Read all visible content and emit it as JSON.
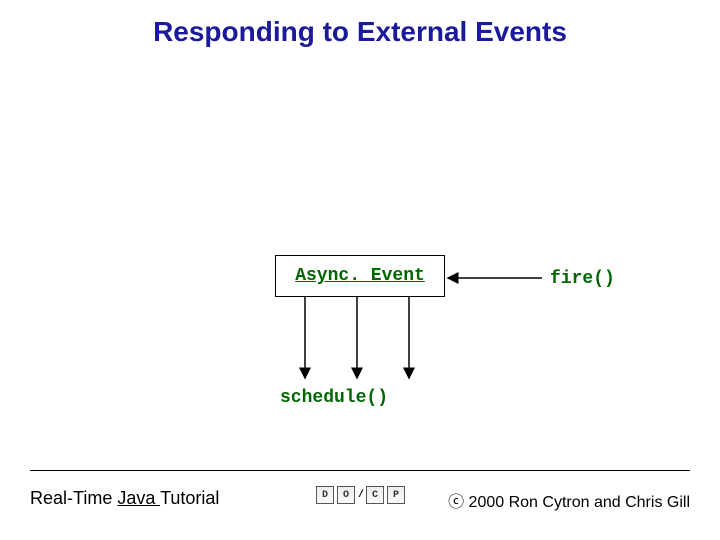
{
  "title": "Responding to External Events",
  "diagram": {
    "box_label": "Async. Event",
    "fire_label": "fire()",
    "schedule_label": "schedule()"
  },
  "footer": {
    "left_prefix": "Real-Time ",
    "left_underlined": "Java ",
    "left_suffix": "Tutorial",
    "copyright": "ⓒ 2000 Ron Cytron and Chris Gill"
  },
  "logo": {
    "chips_left": [
      "D",
      "O"
    ],
    "chips_right": [
      "C",
      "P"
    ],
    "separator": "/"
  }
}
